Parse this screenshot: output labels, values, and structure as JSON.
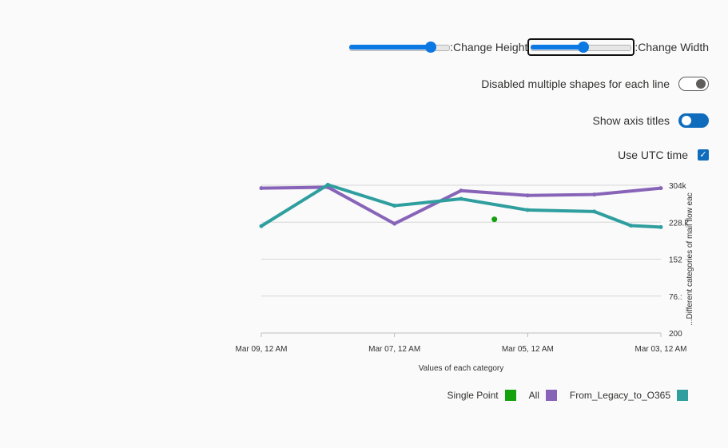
{
  "controls": {
    "height_label": ":Change Height",
    "width_label": ":Change Width",
    "height_slider_value": 0.85,
    "width_slider_value": 0.52,
    "multiple_shapes_label": "Disabled multiple shapes for each line",
    "multiple_shapes_on": false,
    "axis_titles_label": "Show axis titles",
    "axis_titles_on": true,
    "utc_label": "Use UTC time",
    "utc_checked": true
  },
  "colors": {
    "single_point": "#13a10e",
    "all": "#8764b8",
    "from_legacy": "#2f9e9e",
    "accent": "#0f6cbd"
  },
  "chart_data": {
    "type": "line",
    "xlabel": "Values of each category",
    "ylabel": "...Different categories of mail flow eac",
    "x_ticks": [
      "Mar 09, 12 AM",
      "Mar 07, 12 AM",
      "Mar 05, 12 AM",
      "Mar 03, 12 AM"
    ],
    "x_tick_positions": [
      9,
      7,
      5,
      3
    ],
    "x_range": [
      9,
      3
    ],
    "y_ticks": [
      "304k",
      "228.k",
      "152",
      "76.:",
      "200"
    ],
    "y_tick_values": [
      304000,
      228000,
      152000,
      76000,
      0
    ],
    "ylim": [
      0,
      304000
    ],
    "grid": true,
    "legend_position": "bottom-right",
    "series": [
      {
        "name": "All",
        "color": "#8764b8",
        "points": [
          [
            9,
            298000
          ],
          [
            8,
            300000
          ],
          [
            7,
            225000
          ],
          [
            6,
            293000
          ],
          [
            5,
            283000
          ],
          [
            4,
            285000
          ],
          [
            3,
            298000
          ]
        ]
      },
      {
        "name": "From_Legacy_to_O365",
        "color": "#2f9e9e",
        "points": [
          [
            9,
            220000
          ],
          [
            8,
            305000
          ],
          [
            7,
            262000
          ],
          [
            6,
            276000
          ],
          [
            5,
            253000
          ],
          [
            4,
            250000
          ],
          [
            3.45,
            221000
          ],
          [
            3,
            218000
          ]
        ]
      },
      {
        "name": "Single Point",
        "color": "#13a10e",
        "points": [
          [
            5.5,
            234000
          ]
        ]
      }
    ]
  },
  "legend": [
    {
      "label": "Single Point",
      "color": "#13a10e"
    },
    {
      "label": "All",
      "color": "#8764b8"
    },
    {
      "label": "From_Legacy_to_O365",
      "color": "#2f9e9e"
    }
  ]
}
